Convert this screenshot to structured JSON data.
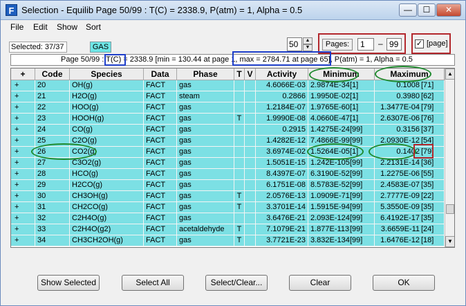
{
  "window": {
    "title": "Selection - Equilib   Page 50/99 : T(C) = 2338.9,  P(atm) = 1, Alpha = 0.5",
    "minimize_label": "—",
    "maximize_label": "☐",
    "close_label": "✕"
  },
  "menu": [
    "File",
    "Edit",
    "Show",
    "Sort"
  ],
  "controls": {
    "selected": "Selected: 37/37",
    "gas_badge": "GAS",
    "per_page": "50",
    "pages_label": "Pages:",
    "page_from": "1",
    "page_dash": "–",
    "page_to": "99",
    "page_checkbox_checked": true,
    "page_checkbox_label": "[page]"
  },
  "info_bar": "Page 50/99 : T(C) = 2338.9 [min = 130.44 at page  1, max = 2784.71 at page  65], P(atm) = 1, Alpha = 0.5",
  "columns": [
    "+",
    "Code",
    "Species",
    "Data",
    "Phase",
    "T",
    "V",
    "Activity",
    "Minimum",
    "Maximum"
  ],
  "rows": [
    {
      "plus": "+",
      "code": "20",
      "species": "OH(g)",
      "data": "FACT",
      "phase": "gas",
      "t": "",
      "v": "",
      "activity": "4.6066E-03",
      "min": "2.9874E-34",
      "min_page": "[1]",
      "max": "0.1008",
      "max_page": "[71]"
    },
    {
      "plus": "+",
      "code": "21",
      "species": "H2O(g)",
      "data": "FACT",
      "phase": "steam",
      "t": "",
      "v": "",
      "activity": "0.2866",
      "min": "1.9950E-02",
      "min_page": "[1]",
      "max": "0.3980",
      "max_page": "[62]"
    },
    {
      "plus": "+",
      "code": "22",
      "species": "HOO(g)",
      "data": "FACT",
      "phase": "gas",
      "t": "",
      "v": "",
      "activity": "1.2184E-07",
      "min": "1.9765E-60",
      "min_page": "[1]",
      "max": "1.3477E-04",
      "max_page": "[79]"
    },
    {
      "plus": "+",
      "code": "23",
      "species": "HOOH(g)",
      "data": "FACT",
      "phase": "gas",
      "t": "T",
      "v": "",
      "activity": "1.9990E-08",
      "min": "4.0660E-47",
      "min_page": "[1]",
      "max": "2.6307E-06",
      "max_page": "[76]"
    },
    {
      "plus": "+",
      "code": "24",
      "species": "CO(g)",
      "data": "FACT",
      "phase": "gas",
      "t": "",
      "v": "",
      "activity": "0.2915",
      "min": "1.4275E-24",
      "min_page": "[99]",
      "max": "0.3156",
      "max_page": "[37]"
    },
    {
      "plus": "+",
      "code": "25",
      "species": "C2O(g)",
      "data": "FACT",
      "phase": "gas",
      "t": "",
      "v": "",
      "activity": "1.4282E-12",
      "min": "7.4866E-99",
      "min_page": "[99]",
      "max": "2.0930E-12",
      "max_page": "[54]"
    },
    {
      "plus": "+",
      "code": "26",
      "species": "CO2(g)",
      "data": "FACT",
      "phase": "gas",
      "t": "",
      "v": "",
      "activity": "3.6974E-02",
      "min": "1.5264E-05",
      "min_page": "[1]",
      "max": "0.1402",
      "max_page": "[79]"
    },
    {
      "plus": "+",
      "code": "27",
      "species": "C3O2(g)",
      "data": "FACT",
      "phase": "gas",
      "t": "",
      "v": "",
      "activity": "1.5051E-15",
      "min": "1.242E-105",
      "min_page": "[99]",
      "max": "2.2131E-14",
      "max_page": "[36]"
    },
    {
      "plus": "+",
      "code": "28",
      "species": "HCO(g)",
      "data": "FACT",
      "phase": "gas",
      "t": "",
      "v": "",
      "activity": "8.4397E-07",
      "min": "6.3190E-52",
      "min_page": "[99]",
      "max": "1.2275E-06",
      "max_page": "[55]"
    },
    {
      "plus": "+",
      "code": "29",
      "species": "H2CO(g)",
      "data": "FACT",
      "phase": "gas",
      "t": "",
      "v": "",
      "activity": "6.1751E-08",
      "min": "8.5783E-52",
      "min_page": "[99]",
      "max": "2.4583E-07",
      "max_page": "[35]"
    },
    {
      "plus": "+",
      "code": "30",
      "species": "CH3OH(g)",
      "data": "FACT",
      "phase": "gas",
      "t": "T",
      "v": "",
      "activity": "2.0576E-13",
      "min": "1.0909E-71",
      "min_page": "[99]",
      "max": "2.7777E-09",
      "max_page": "[22]"
    },
    {
      "plus": "+",
      "code": "31",
      "species": "CH2CO(g)",
      "data": "FACT",
      "phase": "gas",
      "t": "T",
      "v": "",
      "activity": "3.3701E-14",
      "min": "1.5915E-94",
      "min_page": "[99]",
      "max": "5.3550E-09",
      "max_page": "[35]"
    },
    {
      "plus": "+",
      "code": "32",
      "species": "C2H4O(g)",
      "data": "FACT",
      "phase": "gas",
      "t": "",
      "v": "",
      "activity": "3.6476E-21",
      "min": "2.093E-124",
      "min_page": "[99]",
      "max": "6.4192E-17",
      "max_page": "[35]"
    },
    {
      "plus": "+",
      "code": "33",
      "species": "C2H4O(g2)",
      "data": "FACT",
      "phase": "acetaldehyde",
      "t": "T",
      "v": "",
      "activity": "7.1079E-21",
      "min": "1.877E-113",
      "min_page": "[99]",
      "max": "3.6659E-11",
      "max_page": "[24]"
    },
    {
      "plus": "+",
      "code": "34",
      "species": "CH3CH2OH(g)",
      "data": "FACT",
      "phase": "gas",
      "t": "T",
      "v": "",
      "activity": "3.7721E-23",
      "min": "3.832E-134",
      "min_page": "[99]",
      "max": "1.6476E-12",
      "max_page": "[18]"
    }
  ],
  "buttons": {
    "show_selected": "Show Selected",
    "select_all": "Select All",
    "select_clear": "Select/Clear...",
    "clear": "Clear",
    "ok": "OK"
  },
  "colors": {
    "row_fill": "#7ce0e4",
    "highlight_red": "#b3282d",
    "highlight_blue": "#1f3fc9",
    "highlight_green": "#1f8a2e"
  }
}
